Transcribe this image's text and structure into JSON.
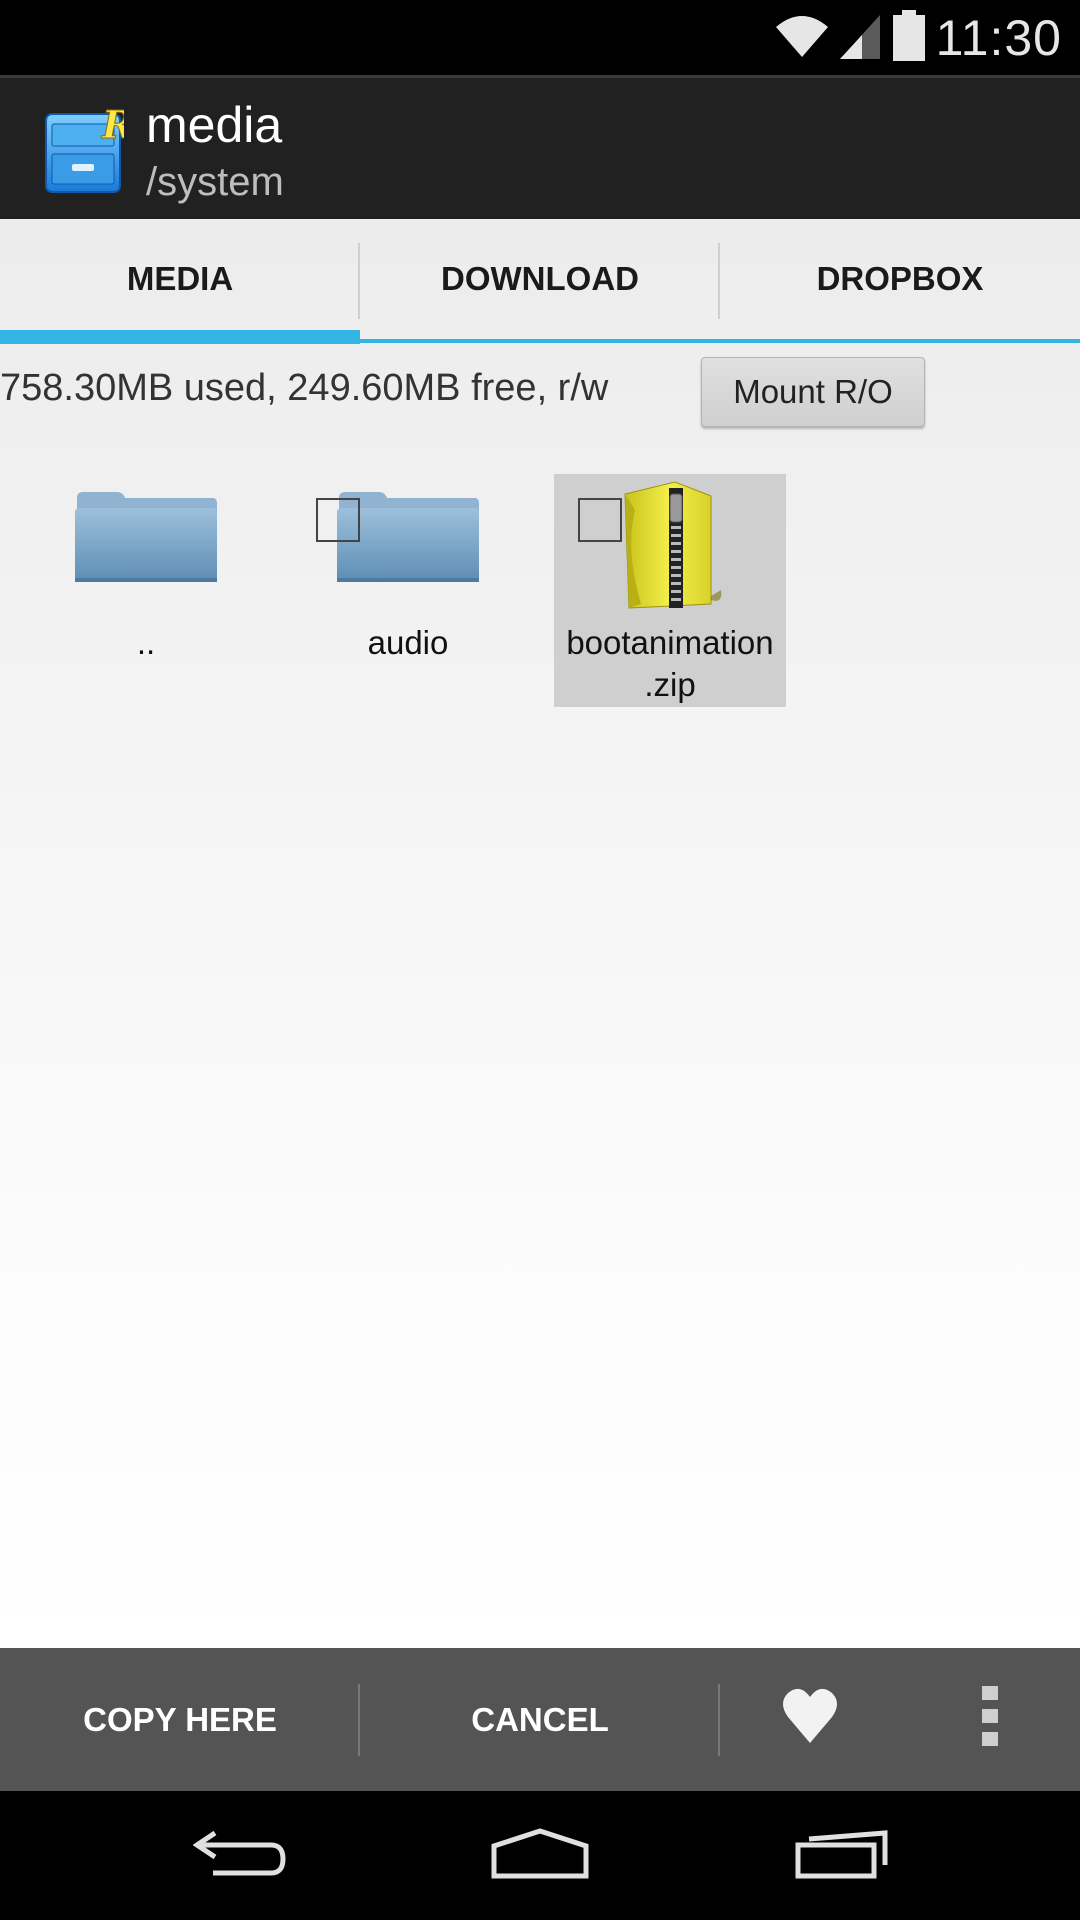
{
  "status_bar": {
    "time": "11:30",
    "icons": [
      "wifi-icon",
      "cell-signal-icon",
      "battery-icon"
    ]
  },
  "action_bar": {
    "app_icon": "root-explorer-cabinet-icon",
    "title": "media",
    "subtitle": "/system"
  },
  "tabs": [
    {
      "label": "MEDIA",
      "active": true
    },
    {
      "label": "DOWNLOAD",
      "active": false
    },
    {
      "label": "DROPBOX",
      "active": false
    }
  ],
  "storage": {
    "info": "758.30MB used, 249.60MB free, r/w",
    "mount_button": "Mount R/O"
  },
  "files": [
    {
      "name": "..",
      "type": "folder",
      "checkbox": false,
      "selected": false
    },
    {
      "name": "audio",
      "type": "folder",
      "checkbox": true,
      "checked": false,
      "selected": false
    },
    {
      "name": "bootanimation\n.zip",
      "name_line1": "bootanimation",
      "name_line2": ".zip",
      "type": "zip",
      "checkbox": true,
      "checked": false,
      "selected": true
    }
  ],
  "bottom_bar": {
    "copy_here": "COPY HERE",
    "cancel": "CANCEL",
    "favorite_icon": "heart-icon",
    "overflow_icon": "overflow-menu-icon"
  },
  "nav_bar": {
    "buttons": [
      "back-icon",
      "home-icon",
      "recents-icon"
    ]
  },
  "colors": {
    "accent": "#33b5e5",
    "action_bar": "#212121",
    "bottom_bar": "#545454",
    "selected_item": "#cfcfcf"
  }
}
